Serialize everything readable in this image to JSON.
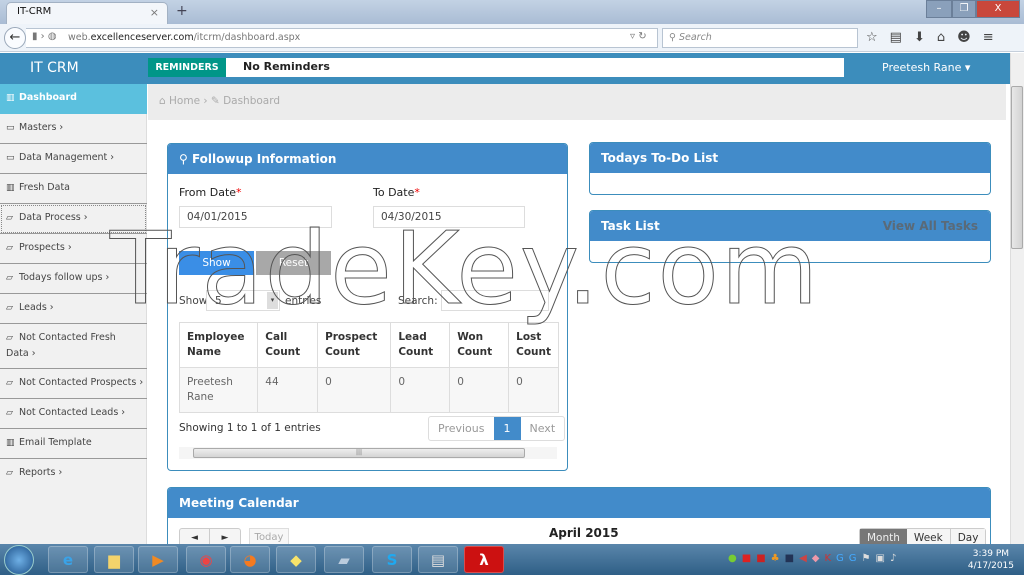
{
  "browser": {
    "tab_title": "IT-CRM",
    "tab_close": "×",
    "new_tab": "+",
    "window_buttons": [
      "–",
      "❐",
      "X"
    ],
    "url_prefix": "web.",
    "url_domain": "excellenceserver.com",
    "url_path": "/itcrm/dashboard.aspx",
    "search_placeholder": "Search",
    "toolbar_icons": [
      "star-icon",
      "reading-list-icon",
      "download-icon",
      "home-icon",
      "chat-icon",
      "menu-icon"
    ]
  },
  "header": {
    "brand": "IT CRM",
    "reminders_label": "REMINDERS",
    "reminders_text": "No Reminders",
    "user": "Preetesh Rane ▾"
  },
  "sidebar": {
    "items": [
      {
        "label": "Dashboard",
        "icon": "chart-icon"
      },
      {
        "label": "Masters ›",
        "icon": "folder-icon"
      },
      {
        "label": "Data Management ›",
        "icon": "folder-icon"
      },
      {
        "label": "Fresh Data",
        "icon": "chart-icon"
      },
      {
        "label": "Data Process ›",
        "icon": "folder-open-icon"
      },
      {
        "label": "Prospects ›",
        "icon": "folder-open-icon"
      },
      {
        "label": "Todays follow ups ›",
        "icon": "folder-open-icon"
      },
      {
        "label": "Leads ›",
        "icon": "folder-open-icon"
      },
      {
        "label": "Not Contacted Fresh Data ›",
        "icon": "folder-open-icon"
      },
      {
        "label": "Not Contacted Prospects ›",
        "icon": "folder-open-icon"
      },
      {
        "label": "Not Contacted Leads ›",
        "icon": "folder-open-icon"
      },
      {
        "label": "Email Template",
        "icon": "chart-icon"
      },
      {
        "label": "Reports ›",
        "icon": "folder-open-icon"
      }
    ]
  },
  "breadcrumb": {
    "home": "Home",
    "sep": "›",
    "current": "Dashboard"
  },
  "followup": {
    "title": "Followup Information",
    "from_label": "From Date",
    "to_label": "To Date",
    "required": "*",
    "from_value": "04/01/2015",
    "to_value": "04/30/2015",
    "show_btn": "Show",
    "reset_btn": "Reset",
    "show_text": "Show",
    "entries_value": "5",
    "entries_text": "entries",
    "search_label": "Search:",
    "columns": [
      "Employee Name",
      "Call Count",
      "Prospect Count",
      "Lead Count",
      "Won Count",
      "Lost Count"
    ],
    "rows": [
      [
        "Preetesh Rane",
        "44",
        "0",
        "0",
        "0",
        "0"
      ]
    ],
    "info": "Showing 1 to 1 of 1 entries",
    "pager": {
      "prev": "Previous",
      "page": "1",
      "next": "Next"
    }
  },
  "todo": {
    "title": "Todays To-Do List"
  },
  "tasks": {
    "title": "Task List",
    "link": "View All Tasks"
  },
  "calendar": {
    "title": "Meeting Calendar",
    "prev": "◄",
    "next": "►",
    "today": "Today",
    "month_title": "April 2015",
    "views": [
      "Month",
      "Week",
      "Day"
    ],
    "active_view": "Month"
  },
  "taskbar": {
    "time": "3:39 PM",
    "date": "4/17/2015",
    "apps": [
      "start",
      "internet-explorer",
      "file-explorer",
      "media-player",
      "chrome",
      "firefox",
      "sticky-notes",
      "notepad",
      "skype",
      "clipboard",
      "acrobat"
    ]
  },
  "watermark": "TradeKey.com"
}
